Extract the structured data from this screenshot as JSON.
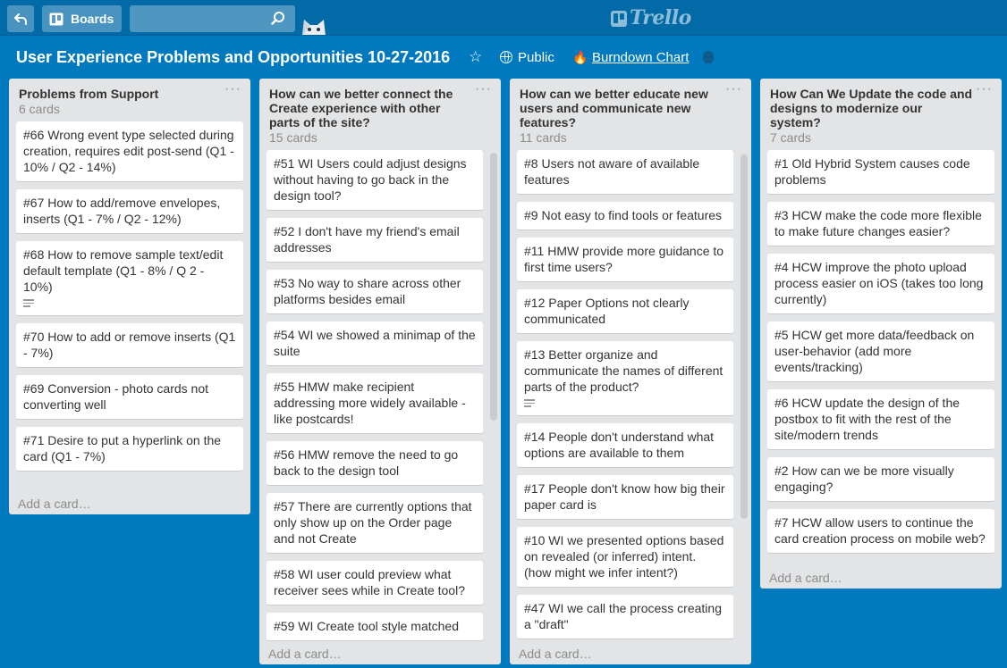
{
  "header": {
    "boards_label": "Boards",
    "search_value": "",
    "logo_text": "Trello"
  },
  "board": {
    "title": "User Experience Problems and Opportunities 10-27-2016",
    "visibility": "Public",
    "powerup_link": "Burndown Chart"
  },
  "colors": {
    "background": "#0079bf",
    "topbar": "#026aa7",
    "list": "#e2e4e6",
    "card": "#ffffff"
  },
  "add_card_label": "Add a card…",
  "lists": [
    {
      "title": "Problems from Support",
      "count": "6 cards",
      "cards": [
        {
          "text": "#66 Wrong event type selected during creation, requires edit post-send (Q1 - 10% / Q2 - 14%)"
        },
        {
          "text": "#67 How to add/remove envelopes, inserts (Q1 - 7% / Q2 - 12%)"
        },
        {
          "text": "#68 How to remove sample text/edit default template (Q1 - 8% / Q 2 - 10%)",
          "description_icon": "description-icon"
        },
        {
          "text": "#70 How to add or remove inserts (Q1 - 7%)"
        },
        {
          "text": "#69 Conversion - photo cards not converting well"
        },
        {
          "text": "#71 Desire to put a hyperlink on the card (Q1 - 7%)"
        }
      ]
    },
    {
      "title": "How can we better connect the Create experience with other parts of the site?",
      "count": "15 cards",
      "cards": [
        {
          "text": "#51 WI Users could adjust designs without having to go back in the design tool?"
        },
        {
          "text": "#52 I don't have my friend's email addresses"
        },
        {
          "text": "#53 No way to share across other platforms besides email"
        },
        {
          "text": "#54 WI we showed a minimap of the suite"
        },
        {
          "text": "#55 HMW make recipient addressing more widely available - like postcards!"
        },
        {
          "text": "#56 HMW remove the need to go back to the design tool"
        },
        {
          "text": "#57 There are currently options that only show up on the Order page and not Create"
        },
        {
          "text": "#58 WI user could preview what receiver sees while in Create tool?"
        },
        {
          "text": "#59 WI Create tool style matched"
        }
      ]
    },
    {
      "title": "How can we better educate new users and communicate new features?",
      "count": "11 cards",
      "cards": [
        {
          "text": "#8 Users not aware of available features"
        },
        {
          "text": "#9 Not easy to find tools or features"
        },
        {
          "text": "#11 HMW provide more guidance to first time users?"
        },
        {
          "text": "#12 Paper Options not clearly communicated"
        },
        {
          "text": "#13 Better organize and communicate the names of different parts of the product?",
          "description_icon": "description-icon"
        },
        {
          "text": "#14 People don't understand what options are available to them"
        },
        {
          "text": "#17 People don't know how big their paper card is"
        },
        {
          "text": "#10 WI we presented options based on revealed (or inferred) intent. (how might we infer intent?)"
        },
        {
          "text": "#47 WI we call the process creating a \"draft\""
        }
      ]
    },
    {
      "title": "How Can We Update the code and designs to modernize our system?",
      "count": "7 cards",
      "cards": [
        {
          "text": "#1 Old Hybrid System causes code problems"
        },
        {
          "text": "#3 HCW make the code more flexible to make future changes easier?"
        },
        {
          "text": "#4 HCW improve the photo upload process easier on iOS (takes too long currently)"
        },
        {
          "text": "#5 HCW get more data/feedback on user-behavior (add more events/tracking)"
        },
        {
          "text": "#6 HCW update the design of the postbox to fit with the rest of the site/modern trends"
        },
        {
          "text": "#2 How can we be more visually engaging?"
        },
        {
          "text": "#7 HCW allow users to continue the card creation process on mobile web?"
        }
      ]
    }
  ]
}
